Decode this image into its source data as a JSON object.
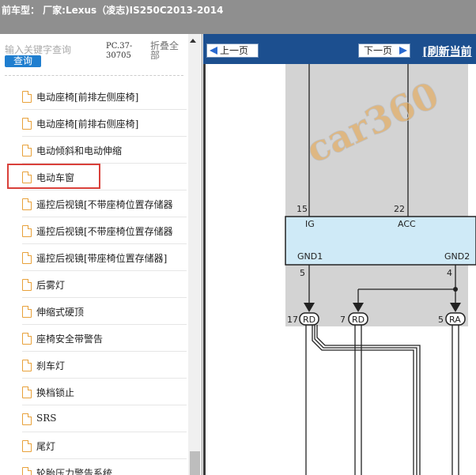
{
  "title_bar": {
    "text": "前车型： 厂家:Lexus（凌志)IS250C2013-2014"
  },
  "sidebar": {
    "search_placeholder": "输入关键字查询",
    "query_button": "查询",
    "pc_code": "PC.37-30705",
    "collapse_all": "折叠全部",
    "selected_item": "电动车窗",
    "items": [
      {
        "label": "电动座椅[前排左侧座椅]"
      },
      {
        "label": "电动座椅[前排右侧座椅]"
      },
      {
        "label": "电动倾斜和电动伸缩"
      },
      {
        "label": "电动车窗"
      },
      {
        "label": "遥控后视镜[不带座椅位置存储器"
      },
      {
        "label": "遥控后视镜[不带座椅位置存储器"
      },
      {
        "label": "遥控后视镜[带座椅位置存储器]"
      },
      {
        "label": "后雾灯"
      },
      {
        "label": "伸缩式硬顶"
      },
      {
        "label": "座椅安全带警告"
      },
      {
        "label": "刹车灯"
      },
      {
        "label": "换档锁止"
      },
      {
        "label": "SRS"
      },
      {
        "label": "尾灯"
      },
      {
        "label": "轮胎压力警告系统"
      }
    ]
  },
  "viewer": {
    "prev_button": "上一页",
    "next_button": "下一页",
    "refresh_link": "[刷新当前",
    "watermark": "car360",
    "diagram": {
      "pins": [
        "15",
        "22",
        "5",
        "4"
      ],
      "component_labels": [
        "IG",
        "ACC",
        "GND1",
        "GND2"
      ],
      "connector_numbers": [
        "17",
        "7",
        "5"
      ],
      "connector_labels": [
        "RD",
        "RD",
        "RA"
      ]
    }
  },
  "colors": {
    "title_bar": "#8f8f8f",
    "toolbar": "#1c4f8f",
    "query_button": "#1f7ecf",
    "highlight": "#d9403a",
    "component_fill": "#cfeaf7",
    "diagram_bg": "#d3d3d3"
  }
}
